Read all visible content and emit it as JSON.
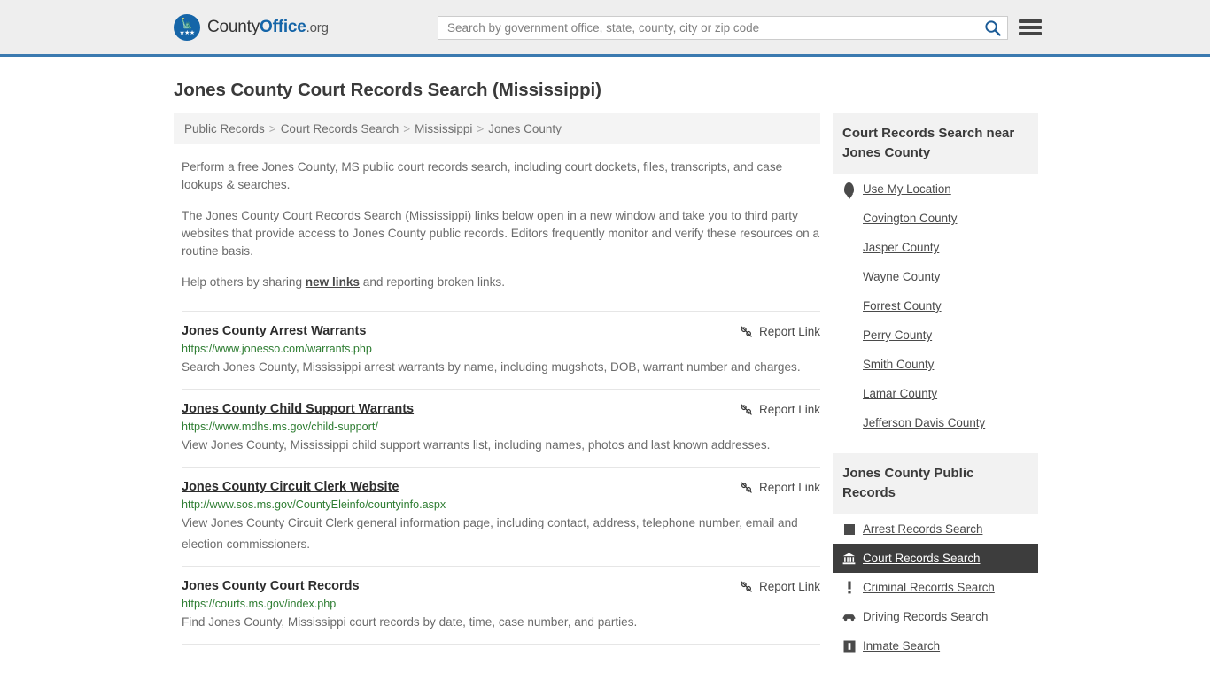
{
  "header": {
    "brand_pre": "County",
    "brand_bold": "Office",
    "brand_tld": ".org",
    "search_placeholder": "Search by government office, state, county, city or zip code",
    "search_value": "",
    "search_icon": "search-icon",
    "menu_icon": "hamburger-menu-icon",
    "accent_color": "#3b7ab0",
    "brand_blue": "#1565a8"
  },
  "page_title": "Jones County Court Records Search (Mississippi)",
  "breadcrumb": {
    "separator": ">",
    "items": [
      {
        "label": "Public Records"
      },
      {
        "label": "Court Records Search"
      },
      {
        "label": "Mississippi"
      },
      {
        "label": "Jones County"
      }
    ]
  },
  "intro": {
    "p1": "Perform a free Jones County, MS public court records search, including court dockets, files, transcripts, and case lookups & searches.",
    "p2": "The Jones County Court Records Search (Mississippi) links below open in a new window and take you to third party websites that provide access to Jones County public records. Editors frequently monitor and verify these resources on a routine basis.",
    "p3_before": "Help others by sharing ",
    "p3_link": "new links",
    "p3_after": " and reporting broken links."
  },
  "report_link_label": "Report Link",
  "report_link_icon": "broken-link-icon",
  "results": [
    {
      "title": "Jones County Arrest Warrants",
      "url": "https://www.jonesso.com/warrants.php",
      "description": "Search Jones County, Mississippi arrest warrants by name, including mugshots, DOB, warrant number and charges."
    },
    {
      "title": "Jones County Child Support Warrants",
      "url": "https://www.mdhs.ms.gov/child-support/",
      "description": "View Jones County, Mississippi child support warrants list, including names, photos and last known addresses."
    },
    {
      "title": "Jones County Circuit Clerk Website",
      "url": "http://www.sos.ms.gov/CountyEleinfo/countyinfo.aspx",
      "description": "View Jones County Circuit Clerk general information page, including contact, address, telephone number, email and election commissioners."
    },
    {
      "title": "Jones County Court Records",
      "url": "https://courts.ms.gov/index.php",
      "description": "Find Jones County, Mississippi court records by date, time, case number, and parties."
    }
  ],
  "sidebar": {
    "nearby": {
      "heading": "Court Records Search near Jones County",
      "use_my_location": {
        "label": "Use My Location",
        "icon": "map-pin-icon"
      },
      "counties": [
        {
          "label": "Covington County"
        },
        {
          "label": "Jasper County"
        },
        {
          "label": "Wayne County"
        },
        {
          "label": "Forrest County"
        },
        {
          "label": "Perry County"
        },
        {
          "label": "Smith County"
        },
        {
          "label": "Lamar County"
        },
        {
          "label": "Jefferson Davis County"
        }
      ]
    },
    "public_records": {
      "heading": "Jones County Public Records",
      "active_color": "#3d3d3d",
      "items": [
        {
          "label": "Arrest Records Search",
          "icon": "square-icon",
          "active": false
        },
        {
          "label": "Court Records Search",
          "icon": "courthouse-icon",
          "active": true
        },
        {
          "label": "Criminal Records Search",
          "icon": "exclamation-icon",
          "active": false
        },
        {
          "label": "Driving Records Search",
          "icon": "car-icon",
          "active": false
        },
        {
          "label": "Inmate Search",
          "icon": "jail-icon",
          "active": false
        }
      ]
    }
  }
}
